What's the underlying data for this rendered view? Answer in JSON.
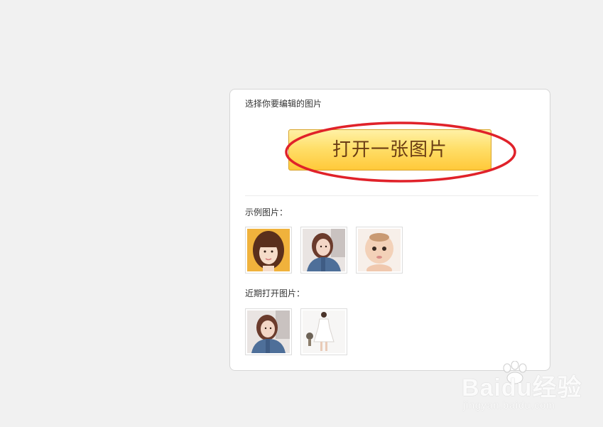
{
  "panel": {
    "title": "选择你要编辑的图片",
    "open_button_label": "打开一张图片",
    "examples_label": "示例图片：",
    "recent_label": "近期打开图片：",
    "example_images": [
      {
        "name": "example-image-girl-bangs"
      },
      {
        "name": "example-image-girl-denim"
      },
      {
        "name": "example-image-baby"
      }
    ],
    "recent_images": [
      {
        "name": "recent-image-girl-denim"
      },
      {
        "name": "recent-image-white-dress"
      }
    ]
  },
  "watermark": {
    "brand": "Baidu经验",
    "url": "jingyan.baidu.com"
  },
  "colors": {
    "background": "#f1f1f1",
    "panel": "#ffffff",
    "button_top": "#fff1a6",
    "button_bottom": "#ffc93a",
    "button_text": "#6b3d14",
    "highlight_ellipse": "#e0222a"
  }
}
